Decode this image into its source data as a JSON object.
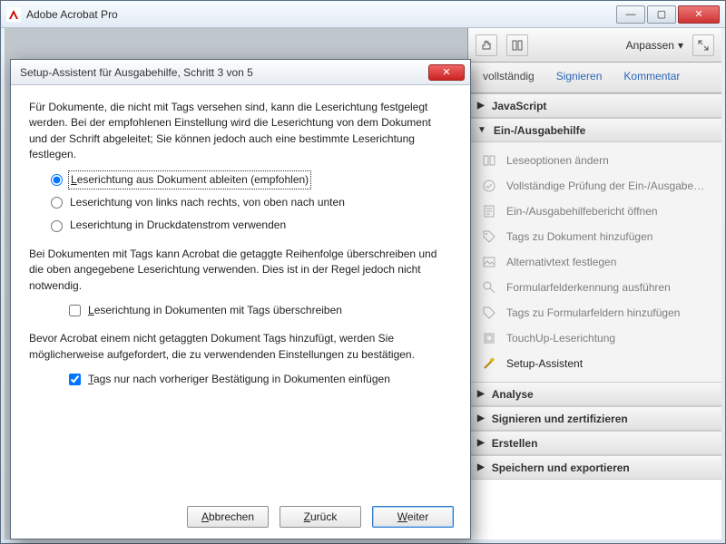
{
  "window": {
    "title": "Adobe Acrobat Pro"
  },
  "toolbar": {
    "anpassen": "Anpassen"
  },
  "tabs": {
    "cutoff": "vollständig",
    "signieren": "Signieren",
    "kommentar": "Kommentar"
  },
  "sections": {
    "javascript": "JavaScript",
    "einausgabe": "Ein-/Ausgabehilfe",
    "analyse": "Analyse",
    "signieren": "Signieren und zertifizieren",
    "erstellen": "Erstellen",
    "speichern": "Speichern und exportieren"
  },
  "tools": {
    "leseoptionen": "Leseoptionen ändern",
    "pruefung": "Vollständige Prüfung der Ein-/Ausgabe…",
    "bericht": "Ein-/Ausgabehilfebericht öffnen",
    "tagsdoc": "Tags zu Dokument hinzufügen",
    "alttext": "Alternativtext festlegen",
    "formular": "Formularfelderkennung ausführen",
    "tagsform": "Tags zu Formularfeldern hinzufügen",
    "touchup": "TouchUp-Leserichtung",
    "setup": "Setup-Assistent"
  },
  "dialog": {
    "title": "Setup-Assistent für Ausgabehilfe, Schritt 3 von 5",
    "para1": "Für Dokumente, die nicht mit Tags versehen sind, kann die Leserichtung festgelegt werden. Bei der empfohlenen Einstellung wird die Leserichtung von dem Dokument und der Schrift abgeleitet; Sie können jedoch auch eine bestimmte Leserichtung festlegen.",
    "radio1": "Leserichtung aus Dokument ableiten (empfohlen)",
    "radio2": "Leserichtung von links nach rechts, von oben nach unten",
    "radio3": "Leserichtung in Druckdatenstrom verwenden",
    "para2": "Bei Dokumenten mit Tags kann Acrobat die getaggte Reihenfolge überschreiben und die oben angegebene Leserichtung verwenden. Dies ist in der Regel jedoch nicht notwendig.",
    "check1": "Leserichtung in Dokumenten mit Tags überschreiben",
    "para3": "Bevor Acrobat einem nicht getaggten Dokument Tags hinzufügt, werden Sie möglicherweise aufgefordert, die zu verwendenden Einstellungen zu bestätigen.",
    "check2": "Tags nur nach vorheriger Bestätigung in Dokumenten einfügen",
    "buttons": {
      "abbrechen": "Abbrechen",
      "zurueck": "Zurück",
      "weiter": "Weiter"
    }
  }
}
